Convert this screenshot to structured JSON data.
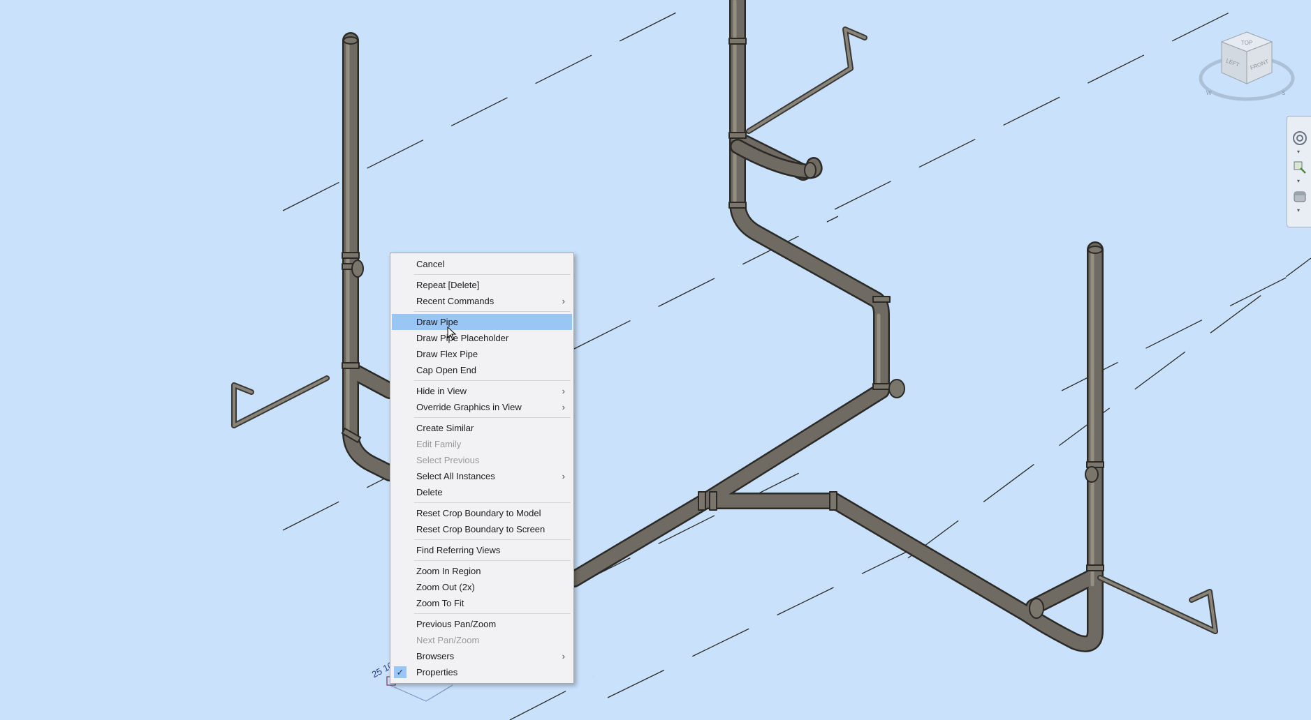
{
  "context_menu": {
    "items": [
      {
        "label": "Cancel",
        "type": "item"
      },
      {
        "type": "separator"
      },
      {
        "label": "Repeat [Delete]",
        "type": "item"
      },
      {
        "label": "Recent Commands",
        "type": "item",
        "submenu": true
      },
      {
        "type": "separator"
      },
      {
        "label": "Draw Pipe",
        "type": "item",
        "highlighted": true
      },
      {
        "label": "Draw Pipe Placeholder",
        "type": "item"
      },
      {
        "label": "Draw Flex Pipe",
        "type": "item"
      },
      {
        "label": "Cap Open End",
        "type": "item"
      },
      {
        "type": "separator"
      },
      {
        "label": "Hide in View",
        "type": "item",
        "submenu": true
      },
      {
        "label": "Override Graphics in View",
        "type": "item",
        "submenu": true
      },
      {
        "type": "separator"
      },
      {
        "label": "Create Similar",
        "type": "item"
      },
      {
        "label": "Edit Family",
        "type": "item",
        "disabled": true
      },
      {
        "label": "Select Previous",
        "type": "item",
        "disabled": true
      },
      {
        "label": "Select All Instances",
        "type": "item",
        "submenu": true
      },
      {
        "label": "Delete",
        "type": "item"
      },
      {
        "type": "separator"
      },
      {
        "label": "Reset Crop Boundary to Model",
        "type": "item"
      },
      {
        "label": "Reset Crop Boundary to Screen",
        "type": "item"
      },
      {
        "type": "separator"
      },
      {
        "label": "Find Referring Views",
        "type": "item"
      },
      {
        "type": "separator"
      },
      {
        "label": "Zoom In Region",
        "type": "item"
      },
      {
        "label": "Zoom Out (2x)",
        "type": "item"
      },
      {
        "label": "Zoom To Fit",
        "type": "item"
      },
      {
        "type": "separator"
      },
      {
        "label": "Previous Pan/Zoom",
        "type": "item"
      },
      {
        "label": "Next Pan/Zoom",
        "type": "item",
        "disabled": true
      },
      {
        "label": "Browsers",
        "type": "item",
        "submenu": true
      },
      {
        "label": "Properties",
        "type": "item",
        "checked": true
      }
    ]
  },
  "viewcube": {
    "faces": {
      "top": "TOP",
      "left": "LEFT",
      "front": "FRONT"
    },
    "compass": [
      "W",
      "S"
    ]
  },
  "dimension_tag": "25 10",
  "colors": {
    "background": "#c9e1fb",
    "pipe": "#6e6a62",
    "menu_highlight": "#99c6f4"
  },
  "icons": [
    "steering-wheel-icon",
    "zoom-icon",
    "pan-icon"
  ]
}
